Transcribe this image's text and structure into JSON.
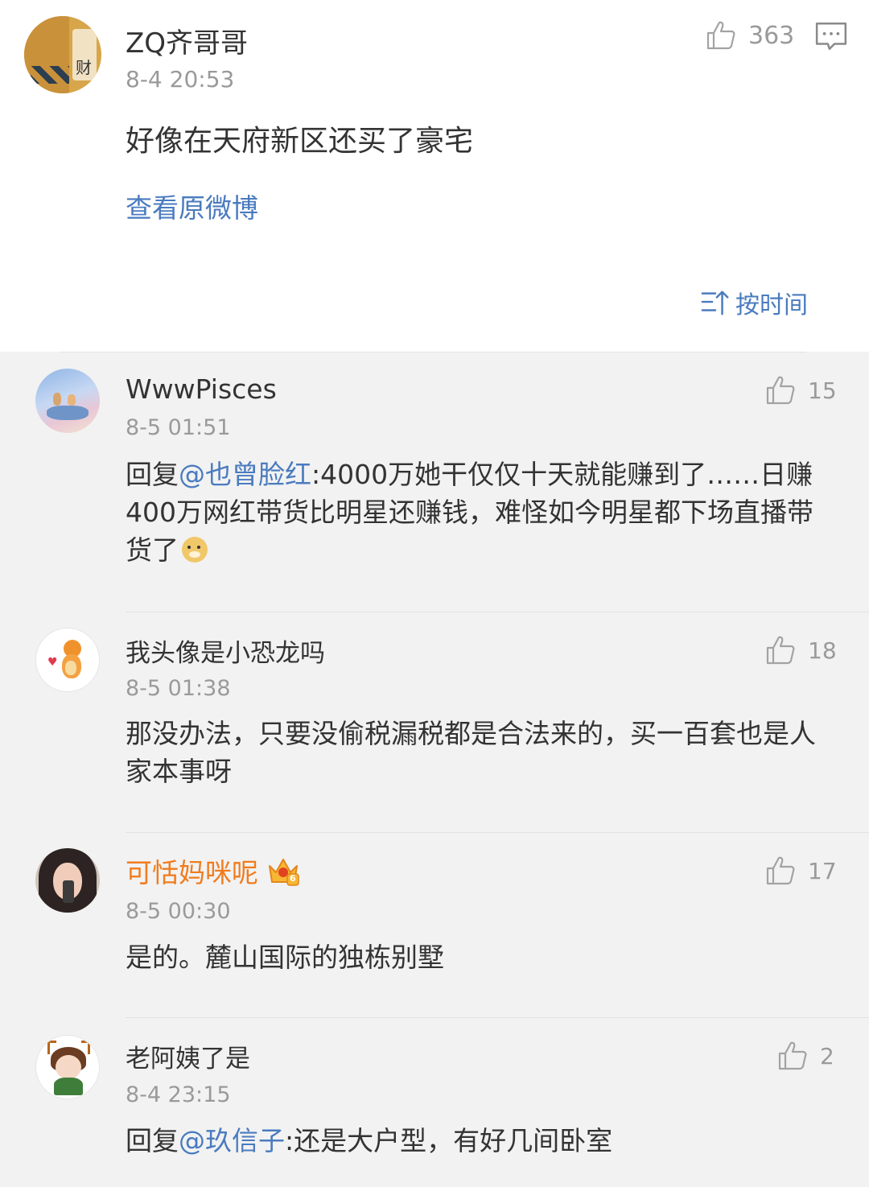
{
  "main_post": {
    "username": "ZQ齐哥哥",
    "time": "8-4 20:53",
    "likes": "363",
    "text": "好像在天府新区还买了豪宅",
    "view_original": "查看原微博",
    "sort_label": "按时间"
  },
  "comments": [
    {
      "username": "WwwPisces",
      "time": "8-5 01:51",
      "likes": "15",
      "reply_prefix": "回复",
      "mention": "@也曾脸红",
      "text": ":4000万她干仅仅十天就能赚到了……日赚400万网红带货比明星还赚钱，难怪如今明星都下场直播带货了"
    },
    {
      "username": "我头像是小恐龙吗",
      "time": "8-5 01:38",
      "likes": "18",
      "text": "那没办法，只要没偷税漏税都是合法来的，买一百套也是人家本事呀"
    },
    {
      "username": "可恬妈咪呢",
      "time": "8-5 00:30",
      "likes": "17",
      "badge": "6",
      "text": "是的。麓山国际的独栋别墅"
    },
    {
      "username": "老阿姨了是",
      "time": "8-4 23:15",
      "likes": "2",
      "reply_prefix": "回复",
      "mention": "@玖信子",
      "text": ":还是大户型，有好几间卧室"
    }
  ],
  "colors": {
    "link": "#4a7bbf",
    "vip_name": "#f07c1e",
    "meta": "#9a9a9a"
  }
}
